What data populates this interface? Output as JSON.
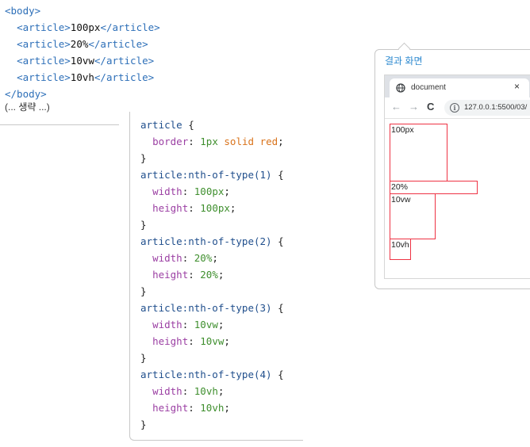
{
  "html_snippet": {
    "body_open": "<body>",
    "articles": [
      {
        "open": "<article>",
        "text": "100px",
        "close": "</article>"
      },
      {
        "open": "<article>",
        "text": "20%",
        "close": "</article>"
      },
      {
        "open": "<article>",
        "text": "10vw",
        "close": "</article>"
      },
      {
        "open": "<article>",
        "text": "10vh",
        "close": "</article>"
      }
    ],
    "body_close": "</body>",
    "ellipsis": "(... 생략 ...)"
  },
  "css_snippet": {
    "rule0": {
      "selector": "article",
      "open": " {",
      "prop": "border",
      "colon": ": ",
      "val_num": "1px",
      "val_kw1": "solid",
      "val_kw2": "red",
      "semi": ";",
      "close": "}"
    },
    "rules": [
      {
        "selector": "article:nth-of-type(1)",
        "open": " {",
        "width_prop": "width",
        "width_val": "100px",
        "height_prop": "height",
        "height_val": "100px",
        "close": "}"
      },
      {
        "selector": "article:nth-of-type(2)",
        "open": " {",
        "width_prop": "width",
        "width_val": "20%",
        "height_prop": "height",
        "height_val": "20%",
        "close": "}"
      },
      {
        "selector": "article:nth-of-type(3)",
        "open": " {",
        "width_prop": "width",
        "width_val": "10vw",
        "height_prop": "height",
        "height_val": "10vw",
        "close": "}"
      },
      {
        "selector": "article:nth-of-type(4)",
        "open": " {",
        "width_prop": "width",
        "width_val": "10vh",
        "height_prop": "height",
        "height_val": "10vh",
        "close": "}"
      }
    ]
  },
  "result": {
    "title": "결과 화면",
    "browser": {
      "tab_title": "document",
      "tab_close": "×",
      "url": "127.0.0.1:5500/03/",
      "icons": {
        "tab": "globe-icon",
        "back": "back-arrow-icon",
        "forward": "forward-arrow-icon",
        "reload": "reload-icon",
        "info": "info-icon"
      }
    },
    "articles": [
      "100px",
      "20%",
      "10vw",
      "10vh"
    ]
  },
  "colors": {
    "border_red": "#ee3344",
    "tag_blue": "#2d6fb8",
    "accent_blue": "#2e8ad0"
  }
}
